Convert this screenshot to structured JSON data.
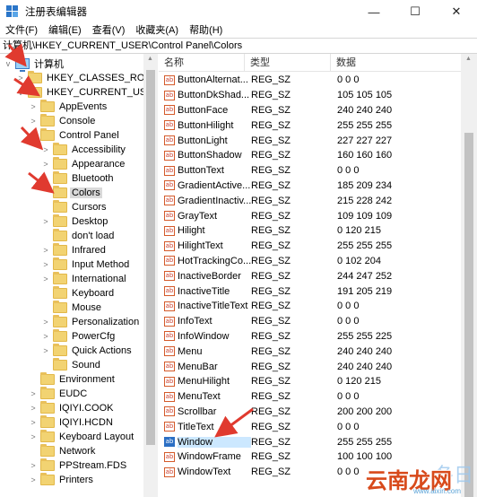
{
  "window": {
    "title": "注册表编辑器",
    "controls": {
      "minimize": "—",
      "maximize": "☐",
      "close": "✕"
    }
  },
  "menu": [
    "文件(F)",
    "编辑(E)",
    "查看(V)",
    "收藏夹(A)",
    "帮助(H)"
  ],
  "address": "计算机\\HKEY_CURRENT_USER\\Control Panel\\Colors",
  "tree": {
    "root": "计算机",
    "items": [
      {
        "label": "HKEY_CLASSES_ROOT",
        "level": 1,
        "expander": ">"
      },
      {
        "label": "HKEY_CURRENT_USER",
        "level": 1,
        "expander": "v"
      },
      {
        "label": "AppEvents",
        "level": 2,
        "expander": ">"
      },
      {
        "label": "Console",
        "level": 2,
        "expander": ">"
      },
      {
        "label": "Control Panel",
        "level": 2,
        "expander": "v"
      },
      {
        "label": "Accessibility",
        "level": 3,
        "expander": ">"
      },
      {
        "label": "Appearance",
        "level": 3,
        "expander": ">"
      },
      {
        "label": "Bluetooth",
        "level": 3,
        "expander": ""
      },
      {
        "label": "Colors",
        "level": 3,
        "expander": "",
        "selected": true
      },
      {
        "label": "Cursors",
        "level": 3,
        "expander": ""
      },
      {
        "label": "Desktop",
        "level": 3,
        "expander": ">"
      },
      {
        "label": "don't load",
        "level": 3,
        "expander": ""
      },
      {
        "label": "Infrared",
        "level": 3,
        "expander": ">"
      },
      {
        "label": "Input Method",
        "level": 3,
        "expander": ">"
      },
      {
        "label": "International",
        "level": 3,
        "expander": ">"
      },
      {
        "label": "Keyboard",
        "level": 3,
        "expander": ""
      },
      {
        "label": "Mouse",
        "level": 3,
        "expander": ""
      },
      {
        "label": "Personalization",
        "level": 3,
        "expander": ">"
      },
      {
        "label": "PowerCfg",
        "level": 3,
        "expander": ">"
      },
      {
        "label": "Quick Actions",
        "level": 3,
        "expander": ">"
      },
      {
        "label": "Sound",
        "level": 3,
        "expander": ""
      },
      {
        "label": "Environment",
        "level": 2,
        "expander": ""
      },
      {
        "label": "EUDC",
        "level": 2,
        "expander": ">"
      },
      {
        "label": "IQIYI.COOK",
        "level": 2,
        "expander": ">"
      },
      {
        "label": "IQIYI.HCDN",
        "level": 2,
        "expander": ">"
      },
      {
        "label": "Keyboard Layout",
        "level": 2,
        "expander": ">"
      },
      {
        "label": "Network",
        "level": 2,
        "expander": ""
      },
      {
        "label": "PPStream.FDS",
        "level": 2,
        "expander": ">"
      },
      {
        "label": "Printers",
        "level": 2,
        "expander": ">"
      }
    ]
  },
  "list": {
    "columns": [
      "名称",
      "类型",
      "数据"
    ],
    "rows": [
      {
        "name": "ButtonAlternat...",
        "type": "REG_SZ",
        "data": "0 0 0"
      },
      {
        "name": "ButtonDkShad...",
        "type": "REG_SZ",
        "data": "105 105 105"
      },
      {
        "name": "ButtonFace",
        "type": "REG_SZ",
        "data": "240 240 240"
      },
      {
        "name": "ButtonHilight",
        "type": "REG_SZ",
        "data": "255 255 255"
      },
      {
        "name": "ButtonLight",
        "type": "REG_SZ",
        "data": "227 227 227"
      },
      {
        "name": "ButtonShadow",
        "type": "REG_SZ",
        "data": "160 160 160"
      },
      {
        "name": "ButtonText",
        "type": "REG_SZ",
        "data": "0 0 0"
      },
      {
        "name": "GradientActive...",
        "type": "REG_SZ",
        "data": "185 209 234"
      },
      {
        "name": "GradientInactiv...",
        "type": "REG_SZ",
        "data": "215 228 242"
      },
      {
        "name": "GrayText",
        "type": "REG_SZ",
        "data": "109 109 109"
      },
      {
        "name": "Hilight",
        "type": "REG_SZ",
        "data": "0 120 215"
      },
      {
        "name": "HilightText",
        "type": "REG_SZ",
        "data": "255 255 255"
      },
      {
        "name": "HotTrackingCo...",
        "type": "REG_SZ",
        "data": "0 102 204"
      },
      {
        "name": "InactiveBorder",
        "type": "REG_SZ",
        "data": "244 247 252"
      },
      {
        "name": "InactiveTitle",
        "type": "REG_SZ",
        "data": "191 205 219"
      },
      {
        "name": "InactiveTitleText",
        "type": "REG_SZ",
        "data": "0 0 0"
      },
      {
        "name": "InfoText",
        "type": "REG_SZ",
        "data": "0 0 0"
      },
      {
        "name": "InfoWindow",
        "type": "REG_SZ",
        "data": "255 255 225"
      },
      {
        "name": "Menu",
        "type": "REG_SZ",
        "data": "240 240 240"
      },
      {
        "name": "MenuBar",
        "type": "REG_SZ",
        "data": "240 240 240"
      },
      {
        "name": "MenuHilight",
        "type": "REG_SZ",
        "data": "0 120 215"
      },
      {
        "name": "MenuText",
        "type": "REG_SZ",
        "data": "0 0 0"
      },
      {
        "name": "Scrollbar",
        "type": "REG_SZ",
        "data": "200 200 200"
      },
      {
        "name": "TitleText",
        "type": "REG_SZ",
        "data": "0 0 0"
      },
      {
        "name": "Window",
        "type": "REG_SZ",
        "data": "255 255 255",
        "selected": true
      },
      {
        "name": "WindowFrame",
        "type": "REG_SZ",
        "data": "100 100 100"
      },
      {
        "name": "WindowText",
        "type": "REG_SZ",
        "data": "0 0 0"
      }
    ],
    "icon_text": "ab"
  },
  "watermark": {
    "text": "云南龙网",
    "url": "www.aixiri.com",
    "big": "冬日"
  },
  "colors": {
    "annotation_arrow": "#e03a2f",
    "selection": "#cce8ff",
    "folder": "#f2d372"
  }
}
